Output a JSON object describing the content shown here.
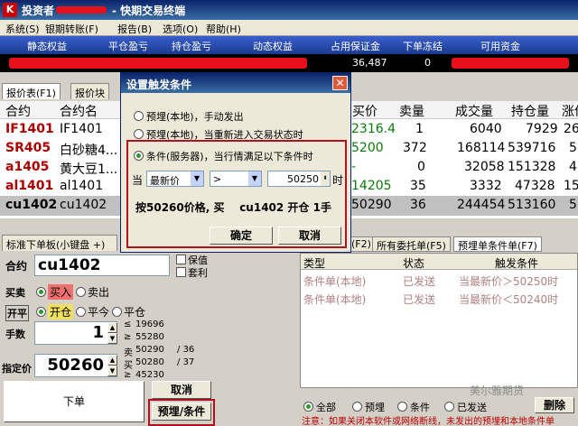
{
  "window": {
    "title": "投资者",
    "title_suffix": "- 快期交易终端",
    "icon_glyph": "K"
  },
  "menu": [
    "系统(S)",
    "银期转账(F)",
    "报告(B)",
    "选项(O)",
    "帮助(H)"
  ],
  "summary_headers": [
    "静态权益",
    "平仓盈亏",
    "持仓盈亏",
    "动态权益",
    "占用保证金",
    "下单冻结",
    "可用资金"
  ],
  "summary_values": {
    "col6": "36,487",
    "col7": "0"
  },
  "tabs": {
    "quote": "报价表(F1)",
    "quote_block": "报价块"
  },
  "quote_headers": [
    "合约",
    "合约名",
    "买价",
    "卖量",
    "成交量",
    "持仓量",
    "涨价"
  ],
  "quote_rows": [
    {
      "code": "IF1401",
      "name": "IF1401",
      "price": "2316.4",
      "vol": "1",
      "turnover": "6040",
      "oi": "7929",
      "chg": "266"
    },
    {
      "code": "SR405",
      "name": "白砂糖4...",
      "price": "5200",
      "vol": "372",
      "turnover": "168114",
      "oi": "539716",
      "chg": "5"
    },
    {
      "code": "a1405",
      "name": "黄大豆1...",
      "price": "-",
      "vol": "0",
      "turnover": "32058",
      "oi": "151328",
      "chg": "4"
    },
    {
      "code": "al1401",
      "name": "al1401",
      "price": "14205",
      "vol": "35",
      "turnover": "3332",
      "oi": "47328",
      "chg": "15"
    },
    {
      "code": "cu1402",
      "name": "cu1402",
      "price": "50290",
      "vol": "36",
      "turnover": "244454",
      "oi": "513160",
      "chg": "5"
    }
  ],
  "order_panel": {
    "tab_label": "标准下单板(小键盘 +)",
    "contract_label": "合约",
    "contract_value": "cu1402",
    "margin_label": "保值",
    "arb_label": "套利",
    "side_label": "买卖",
    "buy_label": "买入",
    "sell_label": "卖出",
    "openclose_label": "开平",
    "open_label": "开仓",
    "close_today_label": "平今",
    "close_label": "平仓",
    "qty_label": "手数",
    "qty_value": "1",
    "price_label": "指定价",
    "price_value": "50260",
    "depth": [
      {
        "mark": "≤",
        "price": "19696"
      },
      {
        "mark": "≥",
        "price": "55280"
      },
      {
        "mark": "卖",
        "price": "50290",
        "vol": "36"
      },
      {
        "mark": "买",
        "price": "50280",
        "vol": "37"
      },
      {
        "mark": "≥",
        "price": "45230"
      }
    ],
    "submit_label": "下单",
    "cancel_label": "取消",
    "preorder_label": "预埋/条件"
  },
  "dialog": {
    "title": "设置触发条件",
    "opt1": "预埋(本地)，手动发出",
    "opt2": "预埋(本地)，当重新进入交易状态时",
    "opt3": "条件(服务器)，当行情满足以下条件时",
    "when_label": "当",
    "field": "最新价",
    "operator": ">",
    "threshold": "50250",
    "time_label": "时",
    "summary": "按50260价格, 买    cu1402 开仓 1手",
    "ok_label": "确定",
    "cancel_label": "取消"
  },
  "right_tabs": [
    "(F2)",
    "所有委托单(F5)",
    "预埋单条件单(F7)"
  ],
  "right_headers": [
    "类型",
    "状态",
    "触发条件"
  ],
  "right_rows": [
    {
      "type": "条件单(本地)",
      "status": "已发送",
      "cond": "当最新价＞50250时"
    },
    {
      "type": "条件单(本地)",
      "status": "已发送",
      "cond": "当最新价＜50240时"
    }
  ],
  "filters": [
    "全部",
    "预埋",
    "条件",
    "已发送"
  ],
  "delete_label": "删除",
  "watermark": "美尔雅期货",
  "note": "注意：如果关闭本软件或网络断线，未发出的预埋和本地条件单"
}
